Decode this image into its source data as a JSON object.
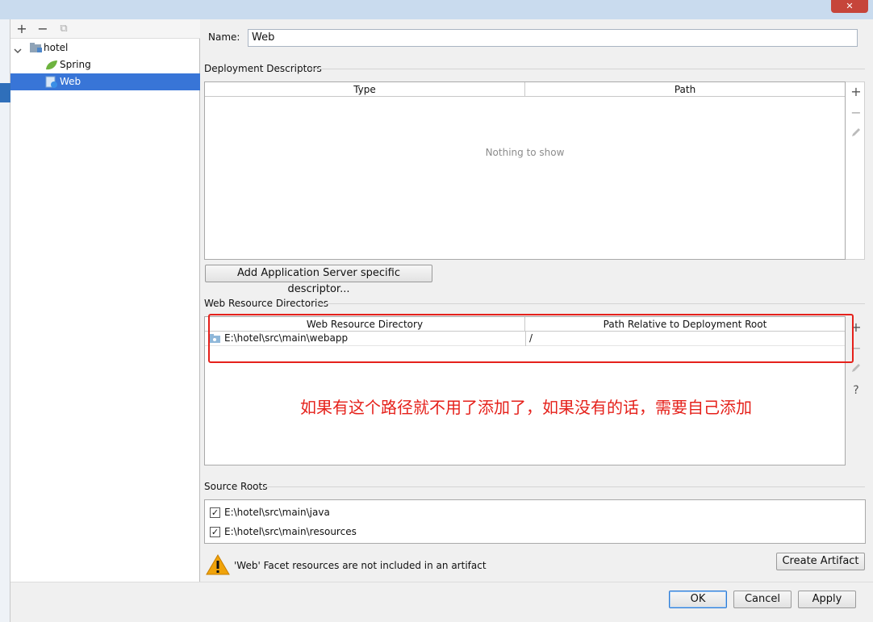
{
  "window": {
    "close_glyph": "✕"
  },
  "tree": {
    "toolbar": [
      "+",
      "−",
      "⧉"
    ],
    "root": "hotel",
    "children": [
      {
        "label": "Spring",
        "icon": "spring-leaf-icon"
      },
      {
        "label": "Web",
        "icon": "web-facet-icon",
        "selected": true
      }
    ]
  },
  "name_label": "Name:",
  "name_value": "Web",
  "deployment": {
    "title": "Deployment Descriptors",
    "columns": [
      "Type",
      "Path"
    ],
    "empty_text": "Nothing to show",
    "add_button": "Add Application Server specific descriptor..."
  },
  "web_resources": {
    "title": "Web Resource Directories",
    "columns": [
      "Web Resource Directory",
      "Path Relative to Deployment Root"
    ],
    "rows": [
      {
        "directory": "E:\\hotel\\src\\main\\webapp",
        "path": "/"
      }
    ],
    "annotation": "如果有这个路径就不用了添加了，如果没有的话，需要自己添加"
  },
  "source_roots": {
    "title": "Source Roots",
    "items": [
      {
        "path": "E:\\hotel\\src\\main\\java",
        "checked": true
      },
      {
        "path": "E:\\hotel\\src\\main\\resources",
        "checked": true
      }
    ]
  },
  "warning": {
    "text": "'Web' Facet resources are not included in an artifact",
    "button": "Create Artifact"
  },
  "footer": {
    "ok": "OK",
    "cancel": "Cancel",
    "apply": "Apply"
  },
  "colors": {
    "selection": "#3875d7",
    "annotation": "#e5211b",
    "warning": "#f0a30a"
  }
}
